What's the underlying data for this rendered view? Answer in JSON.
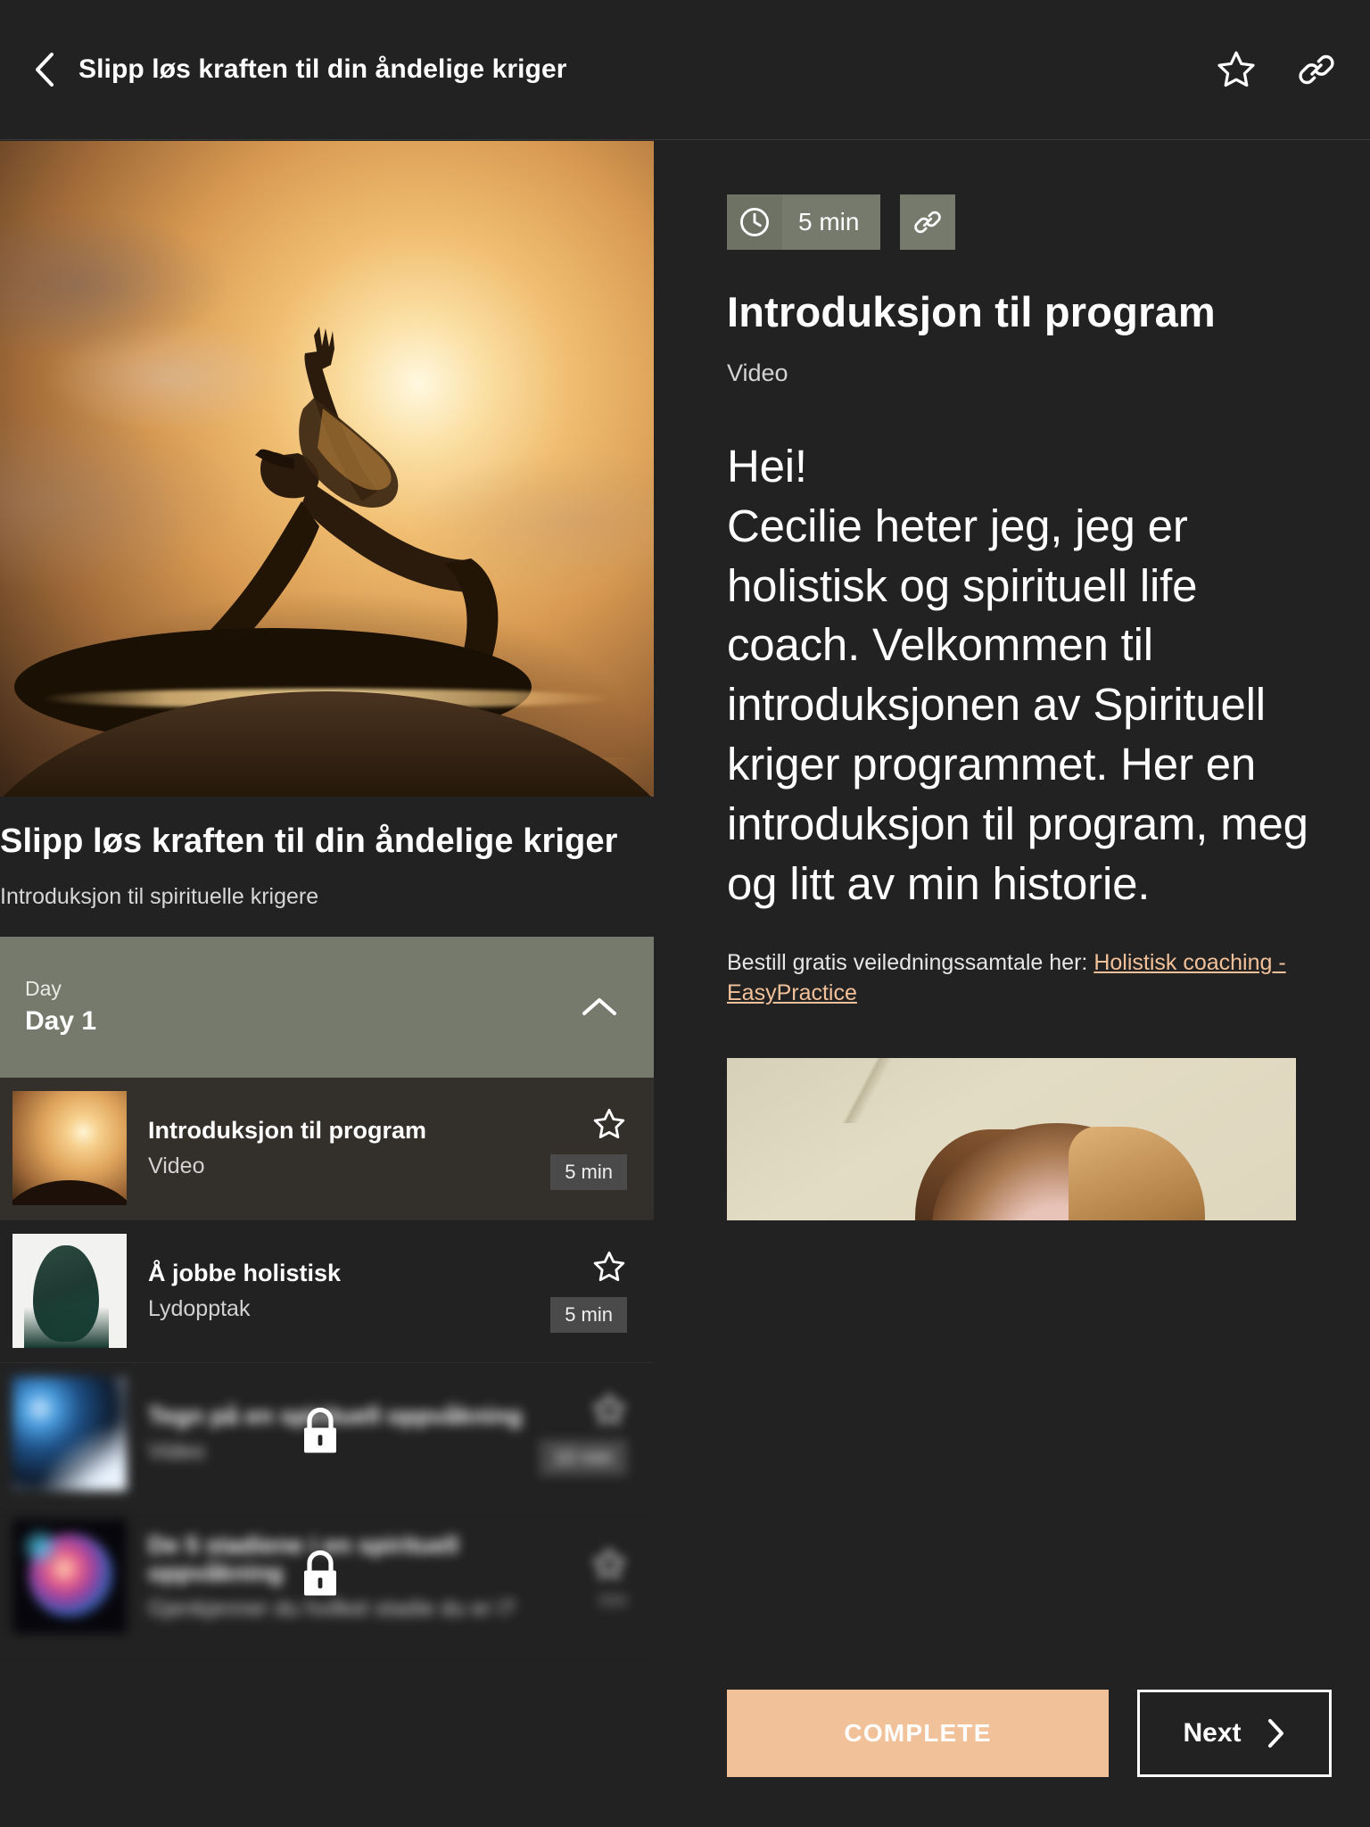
{
  "topbar": {
    "back_icon": "chevron-left-icon",
    "title": "Slipp løs kraften til din åndelige kriger",
    "favorite_icon": "star-outline-icon",
    "link_icon": "link-icon"
  },
  "left": {
    "hero_image_alt": "sunset-yoga-silhouette",
    "title": "Slipp løs kraften til din åndelige kriger",
    "subtitle": "Introduksjon til spirituelle krigere",
    "day_section": {
      "label": "Day",
      "value": "Day 1",
      "chevron_icon": "chevron-up-icon",
      "expanded": true
    },
    "lessons": [
      {
        "title": "Introduksjon til program",
        "kind": "Video",
        "duration": "5 min",
        "star_icon": "star-outline-icon",
        "thumb": "sunset",
        "locked": false,
        "active": true
      },
      {
        "title": "Å jobbe holistisk",
        "kind": "Lydopptak",
        "duration": "5 min",
        "star_icon": "star-outline-icon",
        "thumb": "forest",
        "locked": false,
        "active": false
      },
      {
        "title": "Tegn på en spirituell oppvåkning",
        "kind": "Video",
        "duration": "10 min",
        "star_icon": "star-outline-icon",
        "thumb": "comet",
        "locked": true,
        "lock_icon": "lock-icon",
        "active": false
      },
      {
        "title": "De 5 stadiene i en spirituell oppvåkning",
        "kind": "Gjenkjenner du hvilket stadie du er i?",
        "duration": "",
        "star_icon": "star-outline-icon",
        "thumb": "nebula",
        "locked": true,
        "lock_icon": "lock-icon",
        "active": false
      }
    ]
  },
  "right": {
    "duration_chip": {
      "clock_icon": "clock-icon",
      "text": "5 min"
    },
    "link_chip_icon": "link-icon",
    "title": "Introduksjon til program",
    "kind": "Video",
    "body": "Hei!\nCecilie heter jeg, jeg er holistisk og spirituell life coach. Velkommen til introduksjonen av Spirituell kriger programmet. Her en introduksjon til program, meg og litt av min historie.",
    "note_prefix": "Bestill gratis veiledningssamtale her: ",
    "note_link": "Holistisk coaching - EasyPractice",
    "video_alt": "coach-intro-video-thumbnail",
    "complete_label": "COMPLETE",
    "next_label": "Next",
    "next_icon": "chevron-right-icon"
  },
  "colors": {
    "background": "#222222",
    "accent_sage": "#767a6c",
    "accent_peach": "#f1c19a",
    "link": "#f2c19a",
    "active_row": "#332f2b",
    "badge": "#4a4a4a"
  }
}
